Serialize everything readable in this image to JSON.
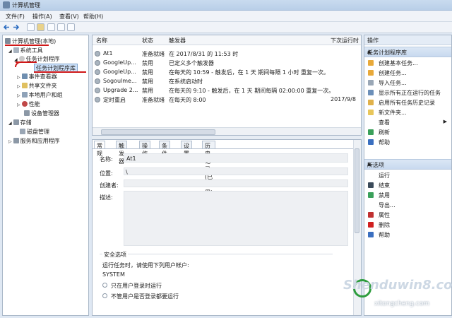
{
  "window": {
    "title": "计算机管理"
  },
  "menu": {
    "file": "文件(F)",
    "action": "操作(A)",
    "view": "查看(V)",
    "help": "帮助(H)"
  },
  "tree": {
    "root": "计算机管理(本地)",
    "system_tools": "系统工具",
    "task_scheduler": "任务计划程序",
    "task_scheduler_library": "任务计划程序库",
    "event_viewer": "事件查看器",
    "shared_folders": "共享文件夹",
    "local_users": "本地用户和组",
    "performance": "性能",
    "device_manager": "设备管理器",
    "storage": "存储",
    "disk_management": "磁盘管理",
    "services_apps": "服务和应用程序"
  },
  "tasklist": {
    "columns": [
      "名称",
      "状态",
      "触发器",
      "下次运行时"
    ],
    "rows": [
      {
        "name": "At1",
        "status": "准备就绪",
        "trigger": "在 2017/8/31 的 11:53 时",
        "next": ""
      },
      {
        "name": "GoogleUp...",
        "status": "禁用",
        "trigger": "已定义多个触发器",
        "next": ""
      },
      {
        "name": "GoogleUp...",
        "status": "禁用",
        "trigger": "在每天的 10:59 - 触发后，在 1 天 期间每隔 1 小时 重复一次。",
        "next": ""
      },
      {
        "name": "Sogoulme...",
        "status": "禁用",
        "trigger": "在系统启动时",
        "next": ""
      },
      {
        "name": "Upgrade 2...",
        "status": "禁用",
        "trigger": "在每天的 9:10 - 触发后，在 1 天 期间每隔 02:00:00 重复一次。",
        "next": ""
      },
      {
        "name": "定时重启",
        "status": "准备就绪",
        "trigger": "在每天的 8:00",
        "next": "2017/9/8"
      }
    ]
  },
  "detail": {
    "tabs": [
      "常规",
      "触发器",
      "操作",
      "条件",
      "设置",
      "历史记录(已禁用)"
    ],
    "name_label": "名称:",
    "name_value": "At1",
    "location_label": "位置:",
    "location_value": "\\",
    "author_label": "创建者:",
    "description_label": "描述:",
    "security_title": "安全选项",
    "run_as_label": "运行任务时，请使用下列用户帐户:",
    "run_as_value": "SYSTEM",
    "radio1": "只在用户登录时运行",
    "radio2": "不管用户是否登录都要运行"
  },
  "actions": {
    "header": "操作",
    "group1": "任务计划程序库",
    "group1_items": [
      {
        "label": "创建基本任务...",
        "icon": "create-basic-task-icon",
        "color": "#e8a93a"
      },
      {
        "label": "创建任务...",
        "icon": "create-task-icon",
        "color": "#e8a93a"
      },
      {
        "label": "导入任务...",
        "icon": "import-task-icon",
        "color": "#9aa7b6"
      },
      {
        "label": "显示所有正在运行的任务",
        "icon": "running-tasks-icon",
        "color": "#6c8fb9"
      },
      {
        "label": "启用所有任务历史记录",
        "icon": "history-icon",
        "color": "#e0b14a"
      },
      {
        "label": "新文件夹...",
        "icon": "new-folder-icon",
        "color": "#e8c65a"
      },
      {
        "label": "查看",
        "icon": "view-icon",
        "color": "#ffffff"
      },
      {
        "label": "刷新",
        "icon": "refresh-icon",
        "color": "#3aa05a"
      },
      {
        "label": "帮助",
        "icon": "help-icon",
        "color": "#3a6fc0"
      }
    ],
    "group2": "所选项",
    "group2_items": [
      {
        "label": "运行",
        "icon": "run-icon",
        "color": "#ffffff"
      },
      {
        "label": "结束",
        "icon": "end-icon",
        "color": "#3a4a5a"
      },
      {
        "label": "禁用",
        "icon": "disable-icon",
        "color": "#3aa05a"
      },
      {
        "label": "导出...",
        "icon": "export-icon",
        "color": "#ffffff"
      },
      {
        "label": "属性",
        "icon": "properties-icon",
        "color": "#c03030"
      },
      {
        "label": "删除",
        "icon": "delete-icon",
        "color": "#d02020"
      },
      {
        "label": "帮助",
        "icon": "help-icon",
        "color": "#3a6fc0"
      }
    ]
  },
  "watermark": {
    "main": "Shenduwin8.com",
    "sub": "xitongcheng.com"
  }
}
